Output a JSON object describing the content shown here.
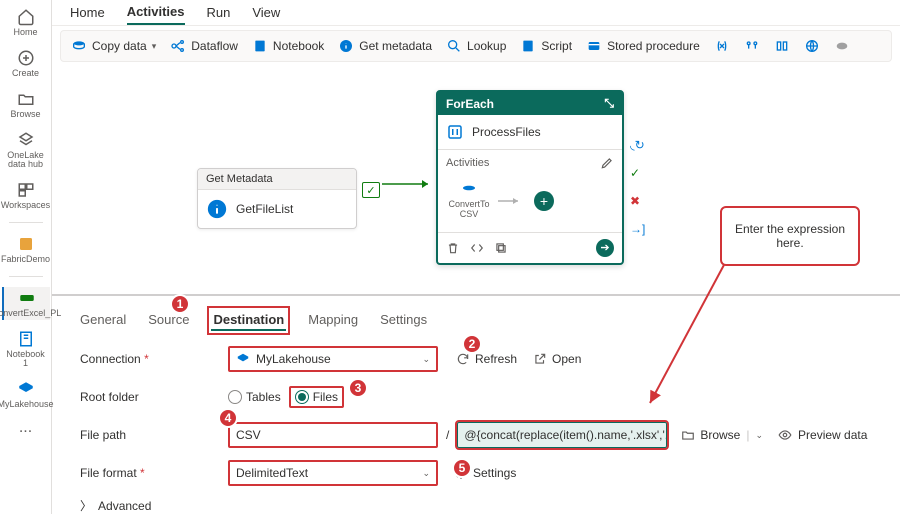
{
  "left_rail": {
    "home": "Home",
    "create": "Create",
    "browse": "Browse",
    "onelake": "OneLake data hub",
    "workspaces": "Workspaces",
    "fabricdemo": "FabricDemo",
    "convert": "ConvertExcel_PL",
    "notebook": "Notebook 1",
    "mylakehouse": "MyLakehouse"
  },
  "top_tabs": {
    "home": "Home",
    "activities": "Activities",
    "run": "Run",
    "view": "View"
  },
  "ribbon": {
    "copy_data": "Copy data",
    "dataflow": "Dataflow",
    "notebook": "Notebook",
    "get_metadata": "Get metadata",
    "lookup": "Lookup",
    "script": "Script",
    "stored_proc": "Stored procedure"
  },
  "pipeline": {
    "get_metadata_title": "Get Metadata",
    "get_metadata_name": "GetFileList",
    "foreach_title": "ForEach",
    "foreach_name": "ProcessFiles",
    "activities_label": "Activities",
    "inner_activity": "ConvertTo CSV"
  },
  "cfg_tabs": {
    "general": "General",
    "source": "Source",
    "destination": "Destination",
    "mapping": "Mapping",
    "settings": "Settings"
  },
  "form": {
    "connection_label": "Connection",
    "connection_value": "MyLakehouse",
    "refresh": "Refresh",
    "open": "Open",
    "root_folder_label": "Root folder",
    "tables": "Tables",
    "files": "Files",
    "file_path_label": "File path",
    "folder_value": "CSV",
    "slash": "/",
    "expr_value": "@{concat(replace(item().name,'.xlsx','...",
    "browse": "Browse",
    "preview": "Preview data",
    "file_format_label": "File format",
    "file_format_value": "DelimitedText",
    "settings_btn": "Settings",
    "advanced": "Advanced"
  },
  "callout_text": "Enter the expression here.",
  "badges": {
    "b1": "1",
    "b2": "2",
    "b3": "3",
    "b4": "4",
    "b5": "5"
  }
}
